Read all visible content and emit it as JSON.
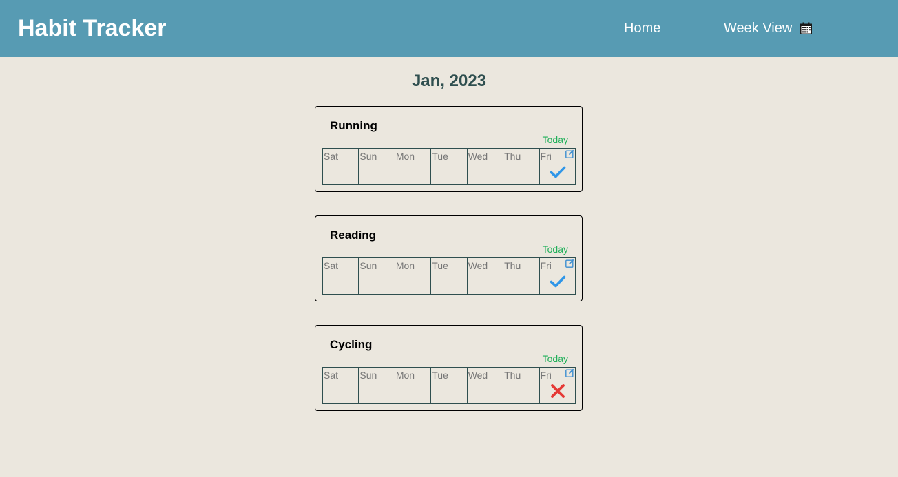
{
  "navbar": {
    "brand": "Habit Tracker",
    "home_label": "Home",
    "week_view_label": "Week View",
    "week_view_icon": "calendar-icon",
    "background_color": "#579bb3"
  },
  "month_title": "Jan, 2023",
  "today_label": "Today",
  "days": [
    "Sat",
    "Sun",
    "Mon",
    "Tue",
    "Wed",
    "Thu",
    "Fri"
  ],
  "habits": [
    {
      "name": "Running",
      "today_status": "done",
      "today_icon": "checkmark-icon"
    },
    {
      "name": "Reading",
      "today_status": "done",
      "today_icon": "checkmark-icon"
    },
    {
      "name": "Cycling",
      "today_status": "not-done",
      "today_icon": "cross-icon"
    }
  ],
  "colors": {
    "page_background": "#ebe7de",
    "today_text": "#21b05a",
    "check": "#2f96e8",
    "cross": "#e53935",
    "edit_icon": "#3e8fd1"
  }
}
